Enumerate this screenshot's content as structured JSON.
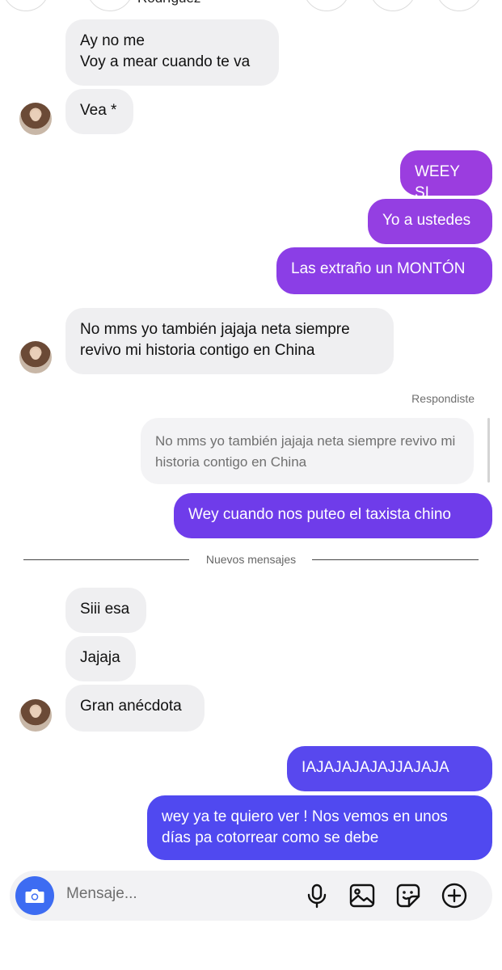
{
  "header": {
    "partial_name": "Rodríguez"
  },
  "messages": [
    {
      "id": "m1",
      "side": "in",
      "text": "Ay no me\nVoy a mear cuando te va"
    },
    {
      "id": "m2",
      "side": "in",
      "text": "Vea *"
    },
    {
      "id": "m3",
      "side": "out",
      "text": "WEEY SI",
      "color": "#9b3ddf"
    },
    {
      "id": "m4",
      "side": "out",
      "text": "Yo a ustedes",
      "color": "#943fe2"
    },
    {
      "id": "m5",
      "side": "out",
      "text": "Las extraño un MONTÓN",
      "color": "#8b3ee6"
    },
    {
      "id": "m6",
      "side": "in",
      "text": "No mms yo también jajaja neta siempre\nrevivo mi historia contigo en China"
    },
    {
      "id": "m7",
      "side": "out",
      "text": "Wey cuando nos puteo el taxista chino",
      "color": "#6f3cea"
    },
    {
      "id": "m8",
      "side": "in",
      "text": "Siii esa"
    },
    {
      "id": "m9",
      "side": "in",
      "text": "Jajaja"
    },
    {
      "id": "m10",
      "side": "in",
      "text": "Gran anécdota"
    },
    {
      "id": "m11",
      "side": "out",
      "text": "IAJAJAJAJAJJAJAJA",
      "color": "#5848ee"
    },
    {
      "id": "m12",
      "side": "out",
      "text": "wey ya te quiero ver ! Nos vemos en unos\ndías pa cotorrear como se debe",
      "color": "#5049f0"
    }
  ],
  "reply": {
    "label": "Respondiste",
    "quoted_text": "No mms yo también jajaja neta siempre revivo mi historia contigo en China"
  },
  "divider": {
    "label": "Nuevos mensajes"
  },
  "composer": {
    "placeholder": "Mensaje...",
    "accent": "#3d6cf2",
    "icons": [
      "camera-icon",
      "microphone-icon",
      "image-icon",
      "sticker-icon",
      "add-icon"
    ]
  }
}
